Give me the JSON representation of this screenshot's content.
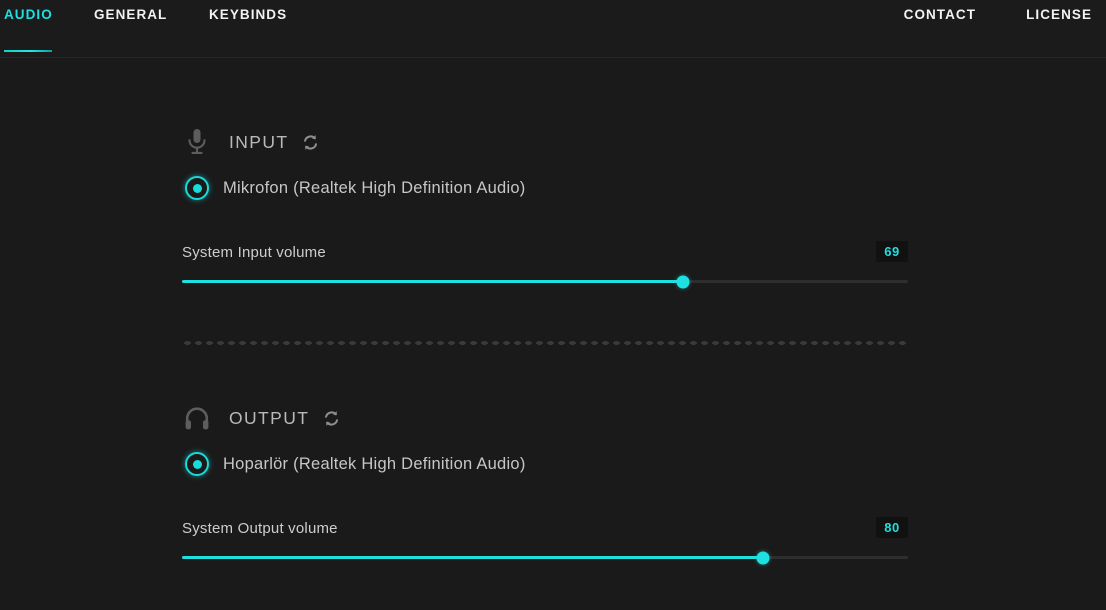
{
  "header": {
    "left_nav": [
      {
        "label": "AUDIO",
        "active": true,
        "name": "tab-audio"
      },
      {
        "label": "GENERAL",
        "active": false,
        "name": "tab-general"
      },
      {
        "label": "KEYBINDS",
        "active": false,
        "name": "tab-keybinds"
      }
    ],
    "right_nav": [
      {
        "label": "CONTACT",
        "name": "nav-contact"
      },
      {
        "label": "LICENSE",
        "name": "nav-license"
      }
    ]
  },
  "colors": {
    "accent": "#1ee0e0",
    "background": "#1a1a1a",
    "header_background": "#1b1b1b",
    "text": "#c9c9c9",
    "track": "#2e2e2e"
  },
  "sections": {
    "input": {
      "title": "INPUT",
      "device_icon": "microphone-icon",
      "refresh_icon": "refresh-icon",
      "device": {
        "label": "Mikrofon (Realtek High Definition Audio)",
        "selected": true
      },
      "slider": {
        "label": "System Input volume",
        "value": 69,
        "min": 0,
        "max": 100
      }
    },
    "output": {
      "title": "OUTPUT",
      "device_icon": "headphones-icon",
      "refresh_icon": "refresh-icon",
      "device": {
        "label": "Hoparlör (Realtek High Definition Audio)",
        "selected": true
      },
      "slider": {
        "label": "System Output volume",
        "value": 80,
        "min": 0,
        "max": 100
      }
    }
  }
}
